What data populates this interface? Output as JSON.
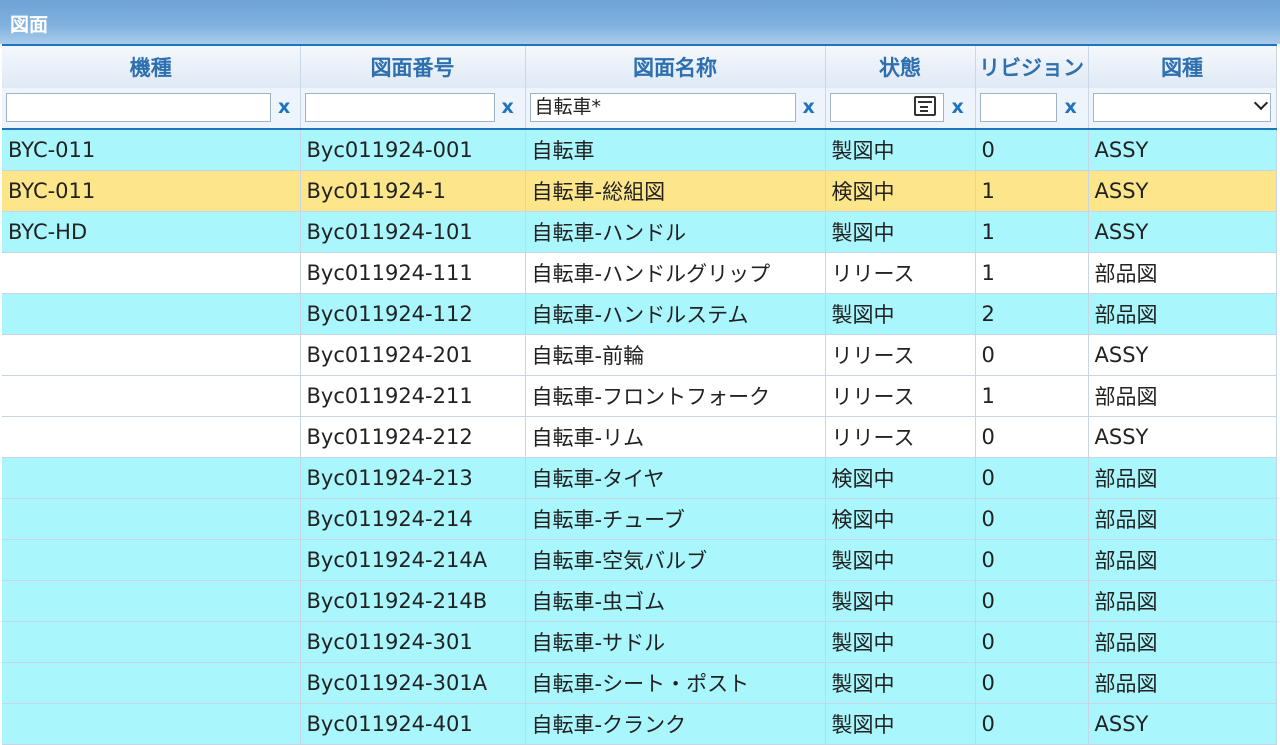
{
  "window": {
    "title": "図面"
  },
  "columns": [
    "機種",
    "図面番号",
    "図面名称",
    "状態",
    "リビジョン",
    "図種"
  ],
  "filters": {
    "model": "",
    "drawing_number": "",
    "drawing_name": "自転車*",
    "status": "",
    "revision": "",
    "type": "",
    "clear_label": "x"
  },
  "row_colors": {
    "cyan": "#a9f6fc",
    "white": "#ffffff",
    "selected": "#fde68a"
  },
  "rows": [
    {
      "style": "cyan",
      "model": "BYC-011",
      "number": "Byc011924-001",
      "name": "自転車",
      "status": "製図中",
      "rev": "0",
      "type": "ASSY"
    },
    {
      "style": "yellow",
      "model": "BYC-011",
      "number": "Byc011924-1",
      "name": "自転車-総組図",
      "status": "検図中",
      "rev": "1",
      "type": "ASSY"
    },
    {
      "style": "cyan",
      "model": "BYC-HD",
      "number": "Byc011924-101",
      "name": "自転車-ハンドル",
      "status": "製図中",
      "rev": "1",
      "type": "ASSY"
    },
    {
      "style": "white",
      "model": "",
      "number": "Byc011924-111",
      "name": "自転車-ハンドルグリップ",
      "status": "リリース",
      "rev": "1",
      "type": "部品図"
    },
    {
      "style": "cyan",
      "model": "",
      "number": "Byc011924-112",
      "name": "自転車-ハンドルステム",
      "status": "製図中",
      "rev": "2",
      "type": "部品図"
    },
    {
      "style": "white",
      "model": "",
      "number": "Byc011924-201",
      "name": "自転車-前輪",
      "status": "リリース",
      "rev": "0",
      "type": "ASSY"
    },
    {
      "style": "white",
      "model": "",
      "number": "Byc011924-211",
      "name": "自転車-フロントフォーク",
      "status": "リリース",
      "rev": "1",
      "type": "部品図"
    },
    {
      "style": "white",
      "model": "",
      "number": "Byc011924-212",
      "name": "自転車-リム",
      "status": "リリース",
      "rev": "0",
      "type": "ASSY"
    },
    {
      "style": "cyan",
      "model": "",
      "number": "Byc011924-213",
      "name": "自転車-タイヤ",
      "status": "検図中",
      "rev": "0",
      "type": "部品図"
    },
    {
      "style": "cyan",
      "model": "",
      "number": "Byc011924-214",
      "name": "自転車-チューブ",
      "status": "検図中",
      "rev": "0",
      "type": "部品図"
    },
    {
      "style": "cyan",
      "model": "",
      "number": "Byc011924-214A",
      "name": "自転車-空気バルブ",
      "status": "製図中",
      "rev": "0",
      "type": "部品図"
    },
    {
      "style": "cyan",
      "model": "",
      "number": "Byc011924-214B",
      "name": "自転車-虫ゴム",
      "status": "製図中",
      "rev": "0",
      "type": "部品図"
    },
    {
      "style": "cyan",
      "model": "",
      "number": "Byc011924-301",
      "name": "自転車-サドル",
      "status": "製図中",
      "rev": "0",
      "type": "部品図"
    },
    {
      "style": "cyan",
      "model": "",
      "number": "Byc011924-301A",
      "name": "自転車-シート・ポスト",
      "status": "製図中",
      "rev": "0",
      "type": "部品図"
    },
    {
      "style": "cyan",
      "model": "",
      "number": "Byc011924-401",
      "name": "自転車-クランク",
      "status": "製図中",
      "rev": "0",
      "type": "ASSY"
    }
  ]
}
